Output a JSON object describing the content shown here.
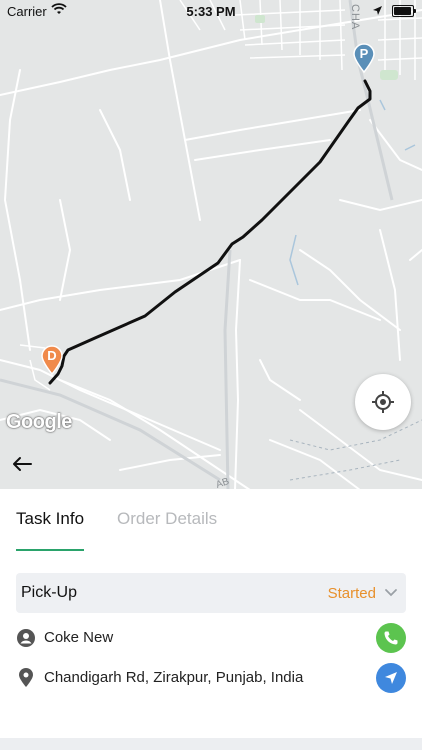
{
  "status_bar": {
    "carrier": "Carrier",
    "time": "5:33 PM"
  },
  "map": {
    "attribution": "Google",
    "pickup_marker_label": "P",
    "dropoff_marker_label": "D",
    "road_label_top": "CHA",
    "road_label_bottom": "AB",
    "pickup_marker_color": "#5a8fb8",
    "dropoff_marker_color": "#f08a4b",
    "route_color": "#111111"
  },
  "tabs": [
    {
      "label": "Task Info",
      "active": true
    },
    {
      "label": "Order Details",
      "active": false
    }
  ],
  "task": {
    "type_label": "Pick-Up",
    "status": "Started",
    "status_color": "#e8902b",
    "customer_name": "Coke New",
    "address": "Chandigarh Rd, Zirakpur, Punjab, India"
  },
  "icons": {
    "back": "arrow-left-icon",
    "locate": "crosshair-icon",
    "person": "person-icon",
    "pin": "location-pin-icon",
    "call": "phone-icon",
    "navigate": "navigation-arrow-icon"
  },
  "colors": {
    "accent": "#2aa36b",
    "call": "#5cc44f",
    "navigate": "#3f88de"
  }
}
